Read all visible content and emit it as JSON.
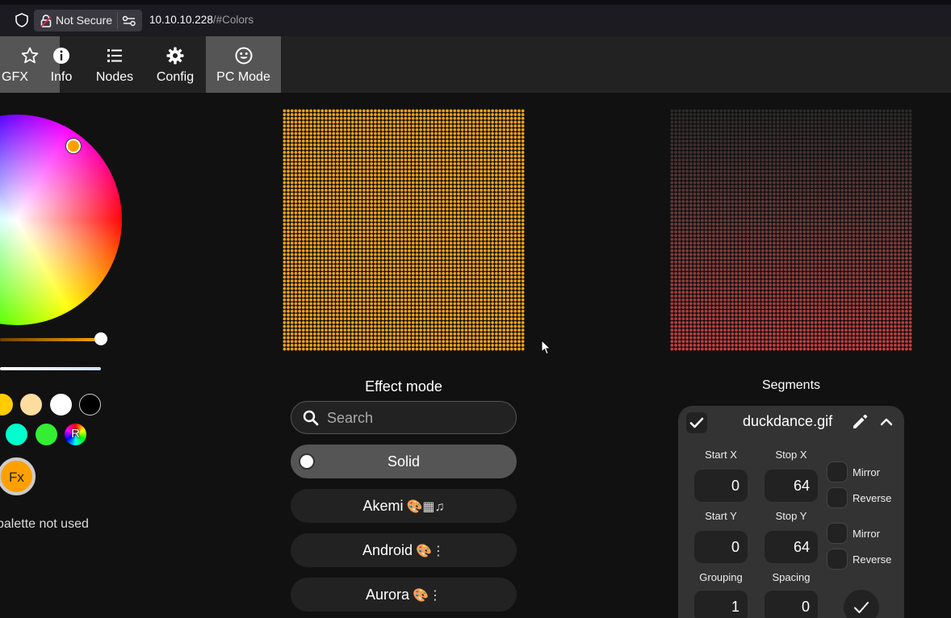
{
  "browser": {
    "security_label": "Not Secure",
    "url_host": "10.10.10.228",
    "url_path": "/#Colors"
  },
  "nav": {
    "items": [
      {
        "label": "GFX",
        "icon": "star-icon",
        "active": true
      },
      {
        "label": "Info",
        "icon": "info-icon",
        "active": false
      },
      {
        "label": "Nodes",
        "icon": "list-icon",
        "active": false
      },
      {
        "label": "Config",
        "icon": "gear-icon",
        "active": false
      },
      {
        "label": "PC Mode",
        "icon": "smiley-icon",
        "active": true
      }
    ]
  },
  "colors": {
    "swatches_row1": [
      "#ffcc00",
      "#ffdca0",
      "#ffffff",
      "#000000"
    ],
    "swatches_row2": [
      "#00ffcc",
      "#33ee33"
    ],
    "random_label": "R",
    "fx_label": "Fx",
    "palette_note": "palette not used",
    "wheel_selected": "#ffa000"
  },
  "effects": {
    "title": "Effect mode",
    "search_placeholder": "Search",
    "items": [
      {
        "name": "Solid",
        "flags": "",
        "selected": true
      },
      {
        "name": "Akemi",
        "flags": "🎨▦♫",
        "selected": false
      },
      {
        "name": "Android",
        "flags": "🎨⋮",
        "selected": false
      },
      {
        "name": "Aurora",
        "flags": "🎨⋮",
        "selected": false
      }
    ]
  },
  "segments": {
    "title": "Segments",
    "segment": {
      "name": "duckdance.gif",
      "start_x_label": "Start X",
      "start_x": "0",
      "stop_x_label": "Stop X",
      "stop_x": "64",
      "start_y_label": "Start Y",
      "start_y": "0",
      "stop_y_label": "Stop Y",
      "stop_y": "64",
      "grouping_label": "Grouping",
      "grouping": "1",
      "spacing_label": "Spacing",
      "spacing": "0",
      "mirror_label": "Mirror",
      "reverse_label": "Reverse"
    }
  }
}
